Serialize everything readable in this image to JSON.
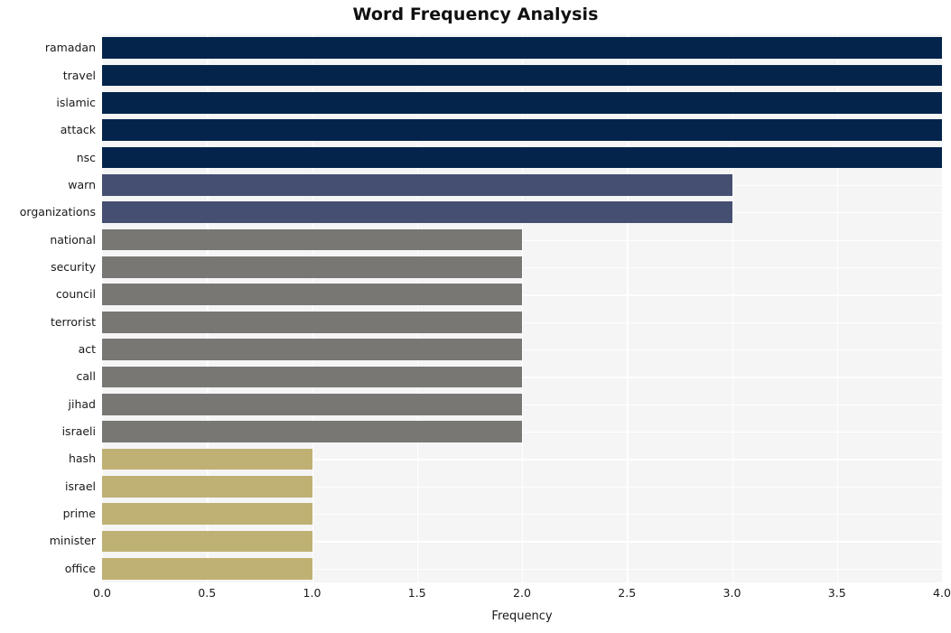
{
  "chart_data": {
    "type": "bar",
    "orientation": "horizontal",
    "title": "Word Frequency Analysis",
    "xlabel": "Frequency",
    "ylabel": "",
    "categories": [
      "ramadan",
      "travel",
      "islamic",
      "attack",
      "nsc",
      "warn",
      "organizations",
      "national",
      "security",
      "council",
      "terrorist",
      "act",
      "call",
      "jihad",
      "israeli",
      "hash",
      "israel",
      "prime",
      "minister",
      "office"
    ],
    "values": [
      4,
      4,
      4,
      4,
      4,
      3,
      3,
      2,
      2,
      2,
      2,
      2,
      2,
      2,
      2,
      1,
      1,
      1,
      1,
      1
    ],
    "xlim": [
      0,
      4
    ],
    "xticks": [
      0,
      0.5,
      1,
      1.5,
      2,
      2.5,
      3,
      3.5,
      4
    ],
    "xtick_labels": [
      "0.0",
      "0.5",
      "1.0",
      "1.5",
      "2.0",
      "2.5",
      "3.0",
      "3.5",
      "4.0"
    ],
    "grid": true,
    "legend": null,
    "bar_colors": [
      "#04244c",
      "#04244c",
      "#04244c",
      "#04244c",
      "#04244c",
      "#454f72",
      "#454f72",
      "#787774",
      "#787774",
      "#787774",
      "#787774",
      "#787774",
      "#787774",
      "#787774",
      "#787774",
      "#bfb173",
      "#bfb173",
      "#bfb173",
      "#bfb173",
      "#bfb173"
    ],
    "palette": {
      "value_4": "#04244c",
      "value_3": "#454f72",
      "value_2": "#787774",
      "value_1": "#bfb173",
      "plot_background": "#f5f5f6",
      "grid_color": "#ffffff",
      "figure_background": "#ffffff",
      "text_color": "#1a1a1a"
    }
  }
}
